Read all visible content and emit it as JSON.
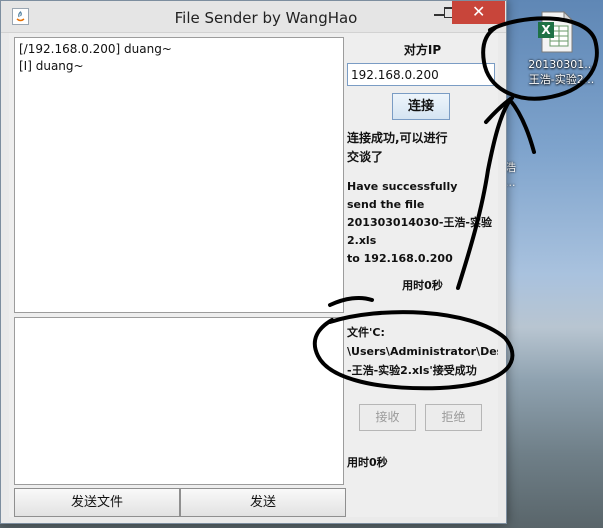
{
  "window": {
    "title": "File Sender by WangHao",
    "controls": {
      "close_glyph": "✕"
    }
  },
  "chat": {
    "lines": [
      "[/192.168.0.200] duang~",
      "[I] duang~"
    ],
    "input_value": ""
  },
  "buttons": {
    "send_file": "发送文件",
    "send": "发送"
  },
  "side": {
    "peer_label": "对方IP",
    "ip_value": "192.168.0.200",
    "connect_label": "连接",
    "status_cn": [
      "连接成功,可以进行",
      "交谈了"
    ],
    "status_en": [
      "Have successfully",
      "send the file",
      "201303014030-王浩-实验",
      "2.xls",
      "to 192.168.0.200"
    ],
    "elapsed_top": "用时0秒",
    "receive_status": [
      "文件'C:",
      "\\Users\\Administrator\\Desk",
      "-王浩-实验2.xls'接受成功"
    ],
    "accept_label": "接收",
    "reject_label": "拒绝",
    "elapsed_bottom": "用时0秒"
  },
  "desktop": {
    "file_label": [
      "20130301...",
      "王浩-实验2..."
    ],
    "fragment": [
      "浩",
      "..."
    ]
  },
  "colors": {
    "close_button": "#c8453a",
    "annotation_ink": "#000000"
  }
}
